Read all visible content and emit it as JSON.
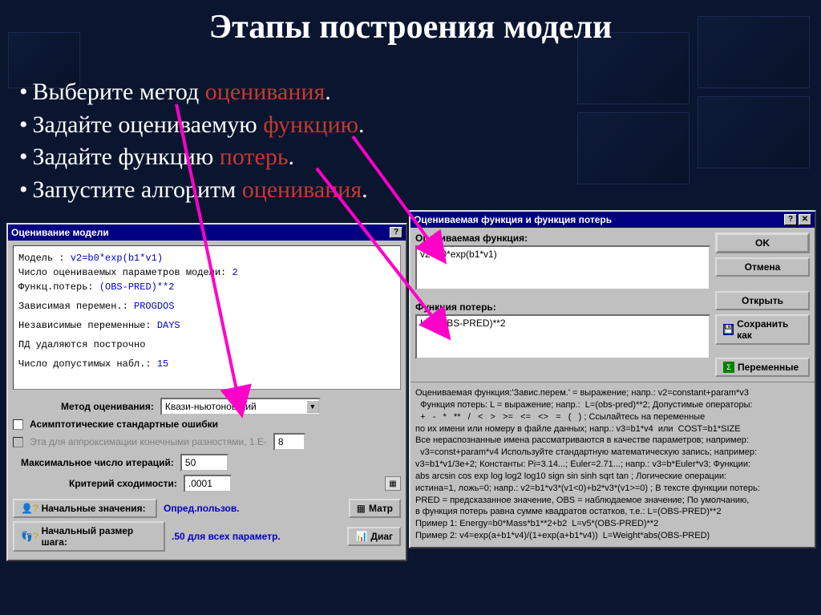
{
  "slide": {
    "title": "Этапы построения модели",
    "bullets": [
      {
        "black": "Выберите метод ",
        "red": "оценивания"
      },
      {
        "black": "Задайте оцениваемую ",
        "red": "функцию"
      },
      {
        "black": "Задайте функцию ",
        "red": "потерь"
      },
      {
        "black": "Запустите алгоритм ",
        "red": "оценивания"
      }
    ]
  },
  "win1": {
    "title": "Оценивание модели",
    "info": {
      "l1a": "Модель :  ",
      "l1b": "v2=b0*exp(b1*v1)",
      "l2a": "Число оцениваемых параметров модели:   ",
      "l2b": "2",
      "l3a": "Функц.потерь:  ",
      "l3b": "(OBS-PRED)**2",
      "l4a": "Зависимая перемен.:   ",
      "l4b": "PROGDOS",
      "l5a": "Независимые переменные:   ",
      "l5b": "DAYS",
      "l6": "ПД удаляются построчно",
      "l7a": "Число допустимых набл.:   ",
      "l7b": "15"
    },
    "method_label": "Метод оценивания:",
    "method_value": "Квази-ньютоновский",
    "cb1": "Асимптотические стандартные ошибки",
    "cb2": "Эта для аппроксимации конечными разностями, 1.E-",
    "cb2_val": "8",
    "iter_label": "Максимальное число итераций:",
    "iter_val": "50",
    "conv_label": "Критерий сходимости:",
    "conv_val": ".0001",
    "btn_init": "Начальные значения:",
    "btn_init_val": "Опред.пользов.",
    "btn_step": "Начальный размер шага:",
    "btn_step_val": ".50 для всех параметр.",
    "btn_matr": "Матр",
    "btn_diag": "Диаг"
  },
  "win2": {
    "title": "Оцениваемая функция и функция потерь",
    "sec1_label": "Оцениваемая функция:",
    "sec1_val": "v2=b0*exp(b1*v1)",
    "sec2_label": "Функция потерь:",
    "sec2_val": "L = (OBS-PRED)**2",
    "btn_ok": "OK",
    "btn_cancel": "Отмена",
    "btn_open": "Открыть",
    "btn_save": "Сохранить как",
    "btn_vars": "Переменные",
    "help": "Оцениваемая функция:'Завис.перем.' = выражение; напр.: v2=constant+param*v3\n  Функция потерь: L = выражение; напр.:  L=(obs-pred)**2; Допустимые операторы:\n  +   -   *   **   /   <   >   >=   <=   <>   =   (   ) ; Ссылайтесь на переменные\nпо их имени или номеру в файле данных; напр.: v3=b1*v4  или  COST=b1*SIZE\nВсе нераспознанные имена рассматриваются в качестве параметров; например:\n  v3=const+param*v4 Используйте стандартную математическую запись; например:\nv3=b1*v1/3e+2; Константы: Pi=3.14...; Euler=2.71...; напр.: v3=b*Euler*v3; Функции:\nabs arcsin cos exp log log2 log10 sign sin sinh sqrt tan ; Логические операции:\nистина=1, ложь=0; напр.: v2=b1*v3*(v1<0)+b2*v3*(v1>=0) ; В тексте функции потерь:\nPRED = предсказанное значение, OBS = наблюдаемое значение; По умолчанию,\nв функция потерь равна сумме квадратов остатков, т.е.: L=(OBS-PRED)**2\nПример 1: Energy=b0*Mass*b1**2+b2  L=v5*(OBS-PRED)**2\nПример 2: v4=exp(a+b1*v4)/(1+exp(a+b1*v4))  L=Weight*abs(OBS-PRED)"
  }
}
